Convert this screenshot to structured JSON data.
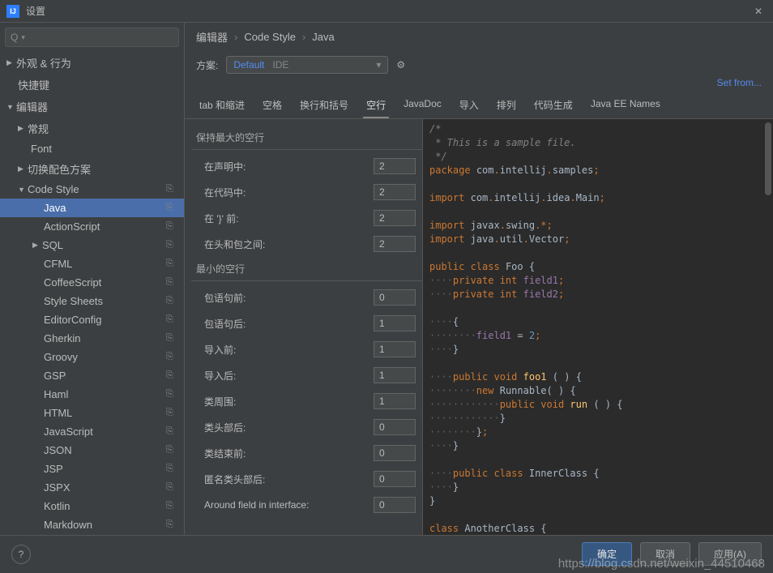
{
  "titlebar": {
    "title": "设置"
  },
  "search": {
    "placeholder": "Q▾"
  },
  "tree": {
    "appearance": "外观 & 行为",
    "keymap": "快捷键",
    "editor": "编辑器",
    "general": "常规",
    "font": "Font",
    "colorScheme": "切换配色方案",
    "codeStyle": "Code Style",
    "items": [
      "Java",
      "ActionScript",
      "SQL",
      "CFML",
      "CoffeeScript",
      "Style Sheets",
      "EditorConfig",
      "Gherkin",
      "Groovy",
      "GSP",
      "Haml",
      "HTML",
      "JavaScript",
      "JSON",
      "JSP",
      "JSPX",
      "Kotlin",
      "Markdown"
    ]
  },
  "breadcrumb": {
    "a": "编辑器",
    "b": "Code Style",
    "c": "Java"
  },
  "scheme": {
    "label": "方案:",
    "default": "Default",
    "ide": "IDE"
  },
  "setFrom": "Set from...",
  "tabs": [
    "tab 和缩进",
    "空格",
    "换行和括号",
    "空行",
    "JavaDoc",
    "导入",
    "排列",
    "代码生成",
    "Java EE Names"
  ],
  "activeTab": 3,
  "sections": {
    "keepMax": "保持最大的空行",
    "minimum": "最小的空行"
  },
  "fieldsMax": [
    {
      "label": "在声明中:",
      "value": "2"
    },
    {
      "label": "在代码中:",
      "value": "2"
    },
    {
      "label": "在 '}' 前:",
      "value": "2"
    },
    {
      "label": "在头和包之间:",
      "value": "2"
    }
  ],
  "fieldsMin": [
    {
      "label": "包语句前:",
      "value": "0"
    },
    {
      "label": "包语句后:",
      "value": "1"
    },
    {
      "label": "导入前:",
      "value": "1"
    },
    {
      "label": "导入后:",
      "value": "1"
    },
    {
      "label": "类周围:",
      "value": "1"
    },
    {
      "label": "类头部后:",
      "value": "0"
    },
    {
      "label": "类结束前:",
      "value": "0"
    },
    {
      "label": "匿名类头部后:",
      "value": "0"
    },
    {
      "label": "Around field in interface:",
      "value": "0"
    }
  ],
  "footer": {
    "ok": "确定",
    "cancel": "取消",
    "apply": "应用(A)"
  },
  "watermark": "https://blog.csdn.net/weixin_44510468",
  "preview": {
    "raw": "/*\n * This is a sample file.\n */\npackage com.intellij.samples;\n\nimport com.intellij.idea.Main;\n\nimport javax.swing.*;\nimport java.util.Vector;\n\npublic class Foo {\n    private int field1;\n    private int field2;\n\n    {\n        field1 = 2;\n    }\n\n    public void foo1 ( ) {\n        new Runnable( ) {\n            public void run ( ) {\n            }\n        };\n    }\n\n    public class InnerClass {\n    }\n}\n\nclass AnotherClass {\n}"
  }
}
